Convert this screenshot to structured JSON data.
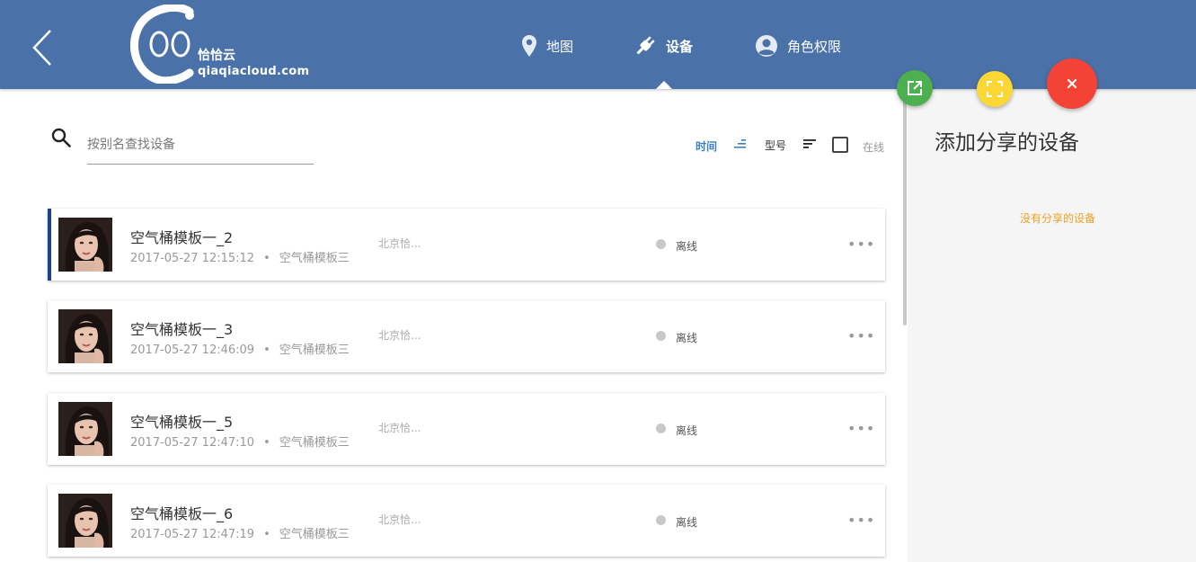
{
  "header": {
    "logo": {
      "cn": "恰恰云",
      "en": "qiaqiacloud.com"
    },
    "nav": [
      {
        "label": "地图",
        "icon": "map-pin-icon"
      },
      {
        "label": "设备",
        "icon": "plug-icon"
      },
      {
        "label": "角色权限",
        "icon": "user-icon"
      }
    ],
    "active_nav": "设备"
  },
  "search": {
    "placeholder": "按别名查找设备",
    "value": ""
  },
  "toolbar": {
    "sort_time_label": "时间",
    "sort_model_label": "型号",
    "online_label": "在线",
    "online_checked": false
  },
  "devices": [
    {
      "name": "空气桶模板一_2",
      "time": "2017-05-27 12:15:12",
      "template": "空气桶模板三",
      "location": "北京恰...",
      "status": "离线",
      "active": true
    },
    {
      "name": "空气桶模板一_3",
      "time": "2017-05-27 12:46:09",
      "template": "空气桶模板三",
      "location": "北京恰...",
      "status": "离线",
      "active": false
    },
    {
      "name": "空气桶模板一_5",
      "time": "2017-05-27 12:47:10",
      "template": "空气桶模板三",
      "location": "北京恰...",
      "status": "离线",
      "active": false
    },
    {
      "name": "空气桶模板一_6",
      "time": "2017-05-27 12:47:19",
      "template": "空气桶模板三",
      "location": "北京恰...",
      "status": "离线",
      "active": false
    }
  ],
  "meta_separator": "•",
  "more_label": "•••",
  "right_panel": {
    "title": "添加分享的设备",
    "empty_text": "没有分享的设备"
  },
  "colors": {
    "header": "#4a72a8",
    "accent_blue": "#3b7fc4",
    "active_bar": "#1f3f8f",
    "fab_green": "#4caf50",
    "fab_yellow": "#fdd835",
    "fab_red": "#f44336",
    "empty_text": "#f0a020"
  }
}
